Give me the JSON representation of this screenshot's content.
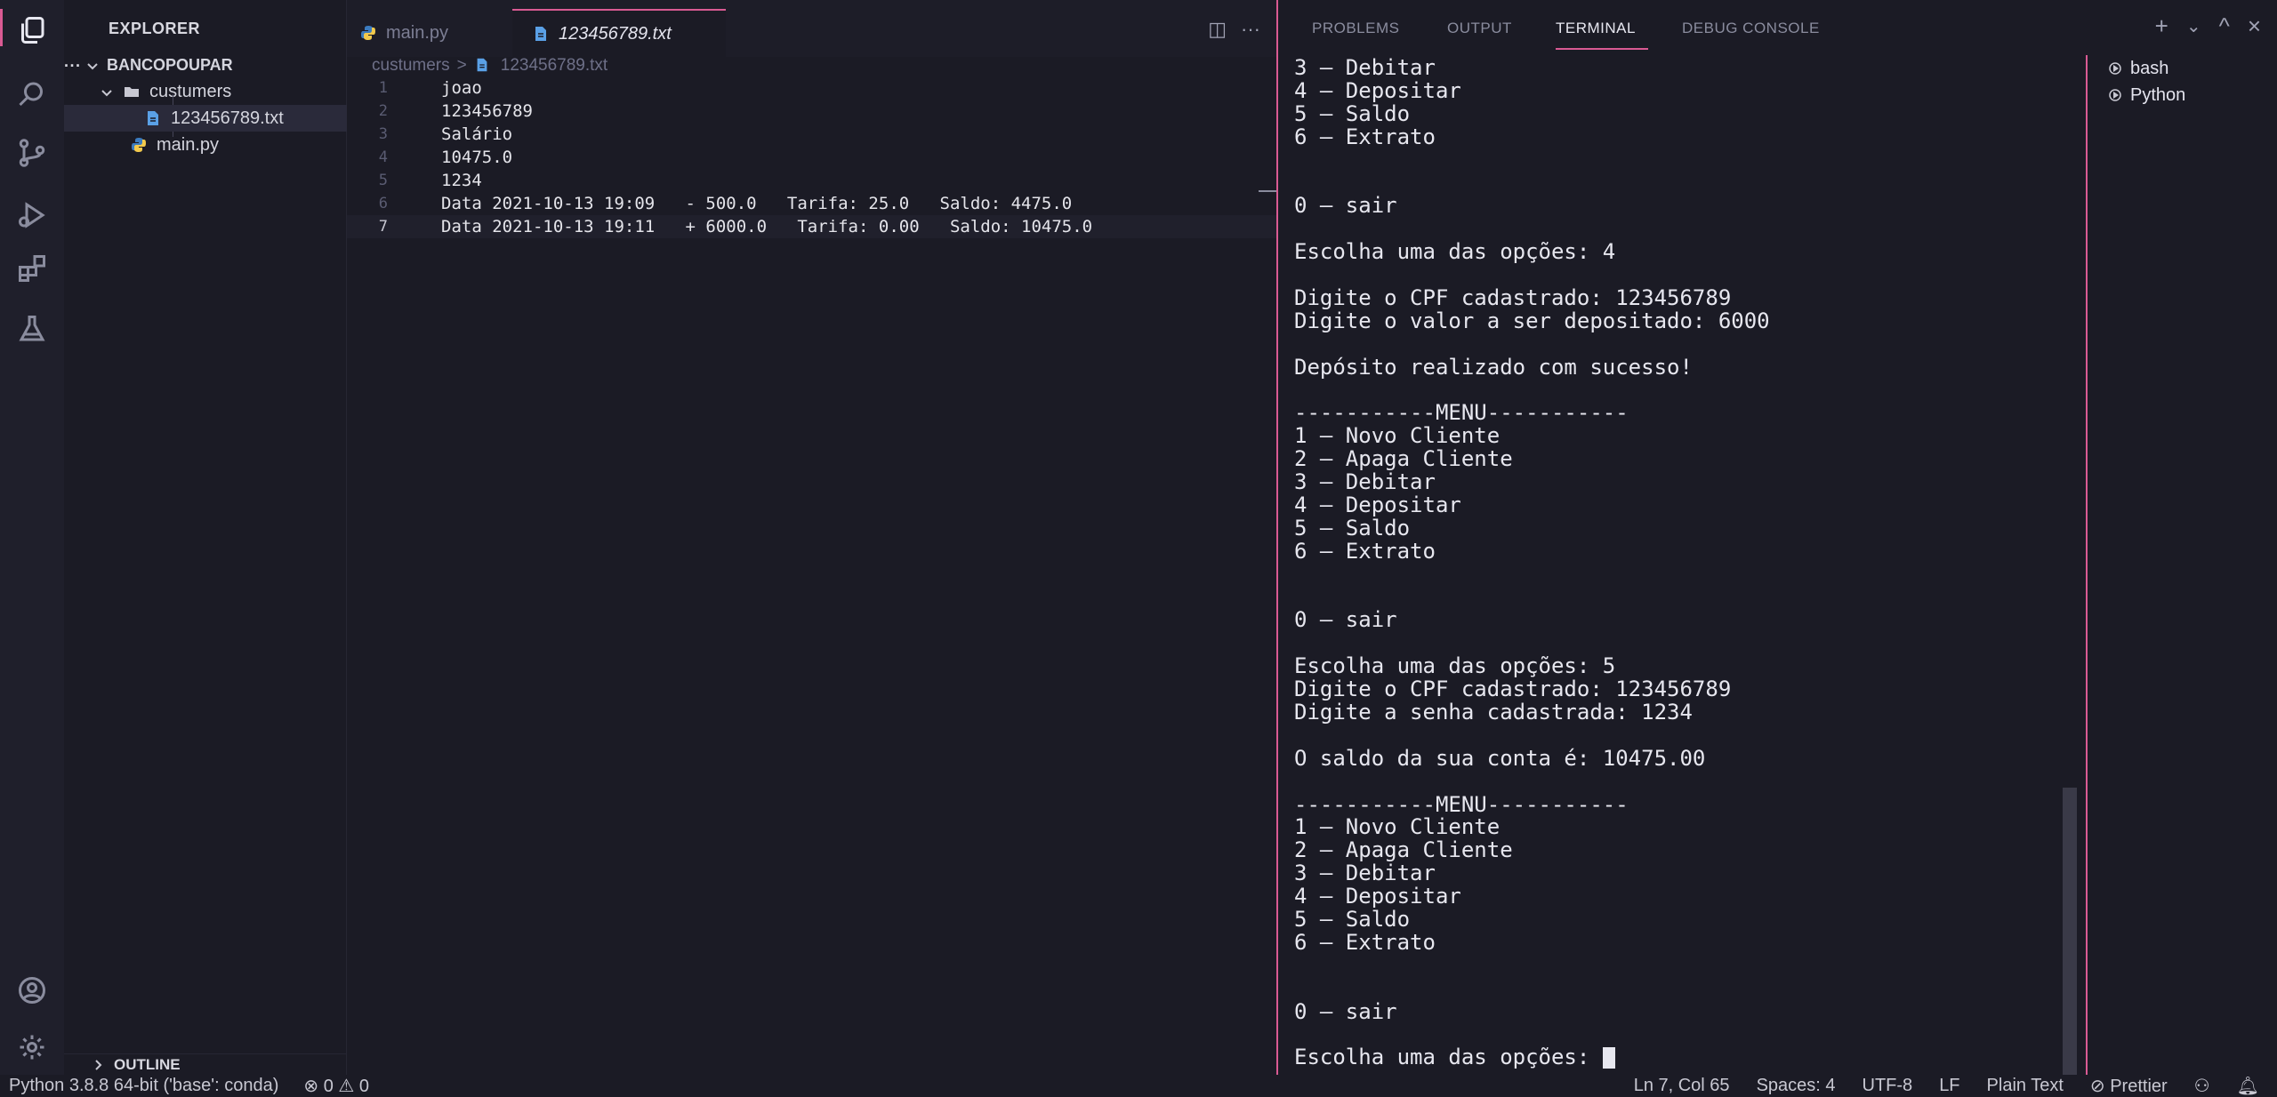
{
  "sidebar": {
    "header": "EXPLORER",
    "more": "···",
    "project": "BANCOPOUPAR",
    "folder": "custumers",
    "file_txt": "123456789.txt",
    "file_py": "main.py",
    "outline": "OUTLINE"
  },
  "editor": {
    "tabs": [
      {
        "label": "main.py"
      },
      {
        "label": "123456789.txt"
      }
    ],
    "breadcrumb": {
      "folder": "custumers",
      "separator": ">",
      "file": "123456789.txt"
    },
    "lines": [
      {
        "num": "1",
        "text": "joao"
      },
      {
        "num": "2",
        "text": "123456789"
      },
      {
        "num": "3",
        "text": "Salário"
      },
      {
        "num": "4",
        "text": "10475.0"
      },
      {
        "num": "5",
        "text": "1234"
      },
      {
        "num": "6",
        "text": "Data 2021-10-13 19:09   - 500.0   Tarifa: 25.0   Saldo: 4475.0"
      },
      {
        "num": "7",
        "text": "Data 2021-10-13 19:11   + 6000.0   Tarifa: 0.00   Saldo: 10475.0"
      }
    ]
  },
  "panel": {
    "tabs": [
      {
        "label": "PROBLEMS"
      },
      {
        "label": "OUTPUT"
      },
      {
        "label": "TERMINAL"
      },
      {
        "label": "DEBUG CONSOLE"
      }
    ],
    "actions": {
      "add": "+",
      "dropdown": "⌄",
      "maximize": "^",
      "close": "×"
    },
    "terminals": [
      {
        "label": "bash"
      },
      {
        "label": "Python"
      }
    ],
    "output": [
      "3 – Debitar",
      "4 – Depositar",
      "5 – Saldo",
      "6 – Extrato",
      "",
      "",
      "0 – sair",
      "",
      "Escolha uma das opções: 4",
      "",
      "Digite o CPF cadastrado: 123456789",
      "Digite o valor a ser depositado: 6000",
      "",
      "Depósito realizado com sucesso!",
      "",
      "-----------MENU-----------",
      "1 – Novo Cliente",
      "2 – Apaga Cliente",
      "3 – Debitar",
      "4 – Depositar",
      "5 – Saldo",
      "6 – Extrato",
      "",
      "",
      "0 – sair",
      "",
      "Escolha uma das opções: 5",
      "Digite o CPF cadastrado: 123456789",
      "Digite a senha cadastrada: 1234",
      "",
      "O saldo da sua conta é: 10475.00",
      "",
      "-----------MENU-----------",
      "1 – Novo Cliente",
      "2 – Apaga Cliente",
      "3 – Debitar",
      "4 – Depositar",
      "5 – Saldo",
      "6 – Extrato",
      "",
      "",
      "0 – sair",
      ""
    ],
    "prompt": "Escolha uma das opções: "
  },
  "statusbar": {
    "interpreter": "Python 3.8.8 64-bit ('base': conda)",
    "problems": "⊗ 0 ⚠ 0",
    "position": "Ln 7, Col 65",
    "spaces": "Spaces: 4",
    "encoding": "UTF-8",
    "eol": "LF",
    "language": "Plain Text",
    "prettier": "⊘ Prettier"
  },
  "colors": {
    "accent": "#d95a93",
    "python_blue": "#3b7bbf",
    "python_yellow": "#f2c94c",
    "txt_blue": "#5aa0e6"
  }
}
